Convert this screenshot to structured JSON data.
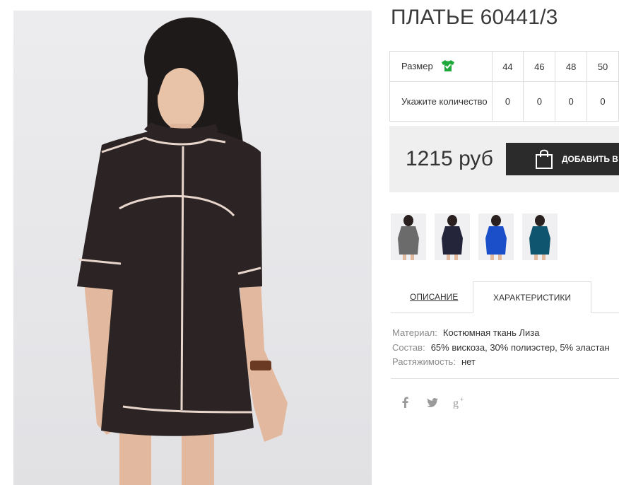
{
  "product": {
    "title": "ПЛАТЬЕ 60441/3"
  },
  "size_table": {
    "size_label": "Размер",
    "size_icon": "tshirt-check-icon",
    "size_icon_color": "#1fa83c",
    "quantity_label": "Укажите количество",
    "sizes": [
      "44",
      "46",
      "48",
      "50"
    ],
    "quantities": [
      "0",
      "0",
      "0",
      "0"
    ]
  },
  "buy": {
    "price": "1215 руб",
    "cart_button_label": "ДОБАВИТЬ В",
    "cart_icon": "shopping-bag-icon"
  },
  "thumbnails": [
    {
      "dress_color": "#6b6b6b"
    },
    {
      "dress_color": "#24243a"
    },
    {
      "dress_color": "#1a4fc9"
    },
    {
      "dress_color": "#0f5570"
    }
  ],
  "tabs": {
    "description": "ОПИСАНИЕ",
    "characteristics": "ХАРАКТЕРИСТИКИ"
  },
  "specs": [
    {
      "label": "Материал:",
      "value": "Костюмная ткань Лиза"
    },
    {
      "label": "Состав:",
      "value": "65% вискоза, 30% полиэстер, 5% эластан"
    },
    {
      "label": "Растяжимость:",
      "value": "нет"
    }
  ],
  "social": [
    "facebook-icon",
    "twitter-icon",
    "google-plus-icon"
  ],
  "colors": {
    "social_icon": "#9a9a9a",
    "dress": "#2c2424",
    "trim": "#e8d6cc"
  }
}
